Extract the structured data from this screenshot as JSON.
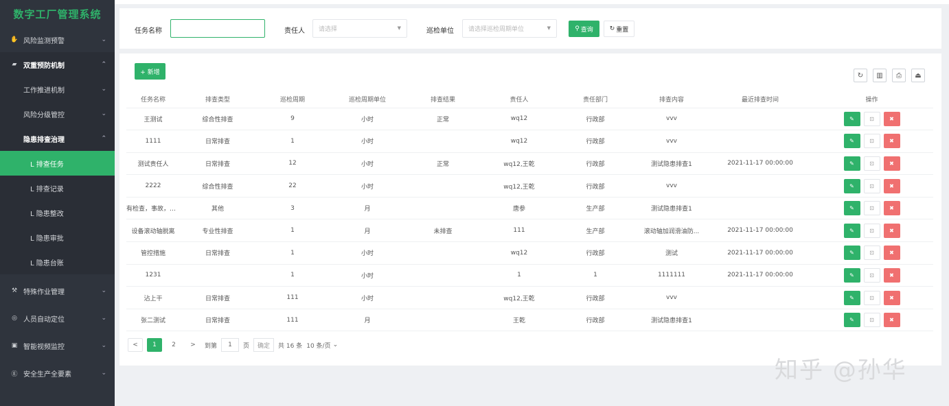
{
  "app": {
    "title": "数字工厂管理系统"
  },
  "sidebar": {
    "items": [
      {
        "label": "风险监测预警",
        "icon": "hand-icon",
        "chevron": "v"
      },
      {
        "label": "双重预防机制",
        "icon": "folder-icon",
        "chevron": "^"
      },
      {
        "label": "工作推进机制",
        "chevron": "v"
      },
      {
        "label": "风险分级管控",
        "chevron": "v"
      },
      {
        "label": "隐患排查治理",
        "chevron": "^"
      },
      {
        "label": "L 排查任务"
      },
      {
        "label": "L 排查记录"
      },
      {
        "label": "L 隐患整改"
      },
      {
        "label": "L 隐患审批"
      },
      {
        "label": "L 隐患台账"
      },
      {
        "label": "特殊作业管理",
        "icon": "wrench-icon",
        "chevron": "v"
      },
      {
        "label": "人员自动定位",
        "icon": "location-icon",
        "chevron": "v"
      },
      {
        "label": "智能视频监控",
        "icon": "camera-icon",
        "chevron": "v"
      },
      {
        "label": "安全生产全要素",
        "icon": "circle-e-icon",
        "chevron": "v"
      }
    ]
  },
  "filter": {
    "task_name_label": "任务名称",
    "task_name_value": "",
    "owner_label": "责任人",
    "owner_placeholder": "请选择",
    "unit_label": "巡检单位",
    "unit_placeholder": "请选择巡检周期单位",
    "query_label": "查询",
    "reset_label": "重置"
  },
  "toolbar": {
    "add_label": "+ 新增"
  },
  "table": {
    "headers": [
      "任务名称",
      "排查类型",
      "巡检周期",
      "巡检周期单位",
      "排查结果",
      "责任人",
      "责任部门",
      "排查内容",
      "最近排查时间",
      "操作"
    ],
    "rows": [
      [
        "王测试",
        "综合性排查",
        "9",
        "小时",
        "正常",
        "wq12",
        "行政部",
        "vvv",
        ""
      ],
      [
        "1111",
        "日常排查",
        "1",
        "小时",
        "",
        "wq12",
        "行政部",
        "vvv",
        ""
      ],
      [
        "测试责任人",
        "日常排查",
        "12",
        "小时",
        "正常",
        "wq12,王乾",
        "行政部",
        "测试隐患排查1",
        "2021-11-17 00:00:00"
      ],
      [
        "2222",
        "综合性排查",
        "22",
        "小时",
        "",
        "wq12,王乾",
        "行政部",
        "vvv",
        ""
      ],
      [
        "有检查，事故，演...",
        "其他",
        "3",
        "月",
        "",
        "唐参",
        "生产部",
        "测试隐患排查1",
        ""
      ],
      [
        "设备滚动轴脱离",
        "专业性排查",
        "1",
        "月",
        "未排查",
        "111",
        "生产部",
        "滚动轴加润滑油防...",
        "2021-11-17 00:00:00"
      ],
      [
        "管控措施",
        "日常排查",
        "1",
        "小时",
        "",
        "wq12",
        "行政部",
        "测试",
        "2021-11-17 00:00:00"
      ],
      [
        "1231",
        "",
        "1",
        "小时",
        "",
        "1",
        "1",
        "1111111",
        "2021-11-17 00:00:00"
      ],
      [
        "沾上干",
        "日常排查",
        "111",
        "小时",
        "",
        "wq12,王乾",
        "行政部",
        "vvv",
        ""
      ],
      [
        "张二测试",
        "日常排查",
        "111",
        "月",
        "",
        "王乾",
        "行政部",
        "测试隐患排查1",
        ""
      ]
    ]
  },
  "pagination": {
    "prev": "<",
    "pages": [
      "1",
      "2"
    ],
    "next": ">",
    "goto_label": "到第",
    "goto_value": "1",
    "page_label": "页",
    "confirm_label": "确定",
    "total": "共 16 条",
    "page_size": "10 条/页"
  },
  "watermark": "知乎 @孙华",
  "colors": {
    "accent": "#2fb26a",
    "danger": "#f07070",
    "sidebar_bg": "#2f343d"
  }
}
